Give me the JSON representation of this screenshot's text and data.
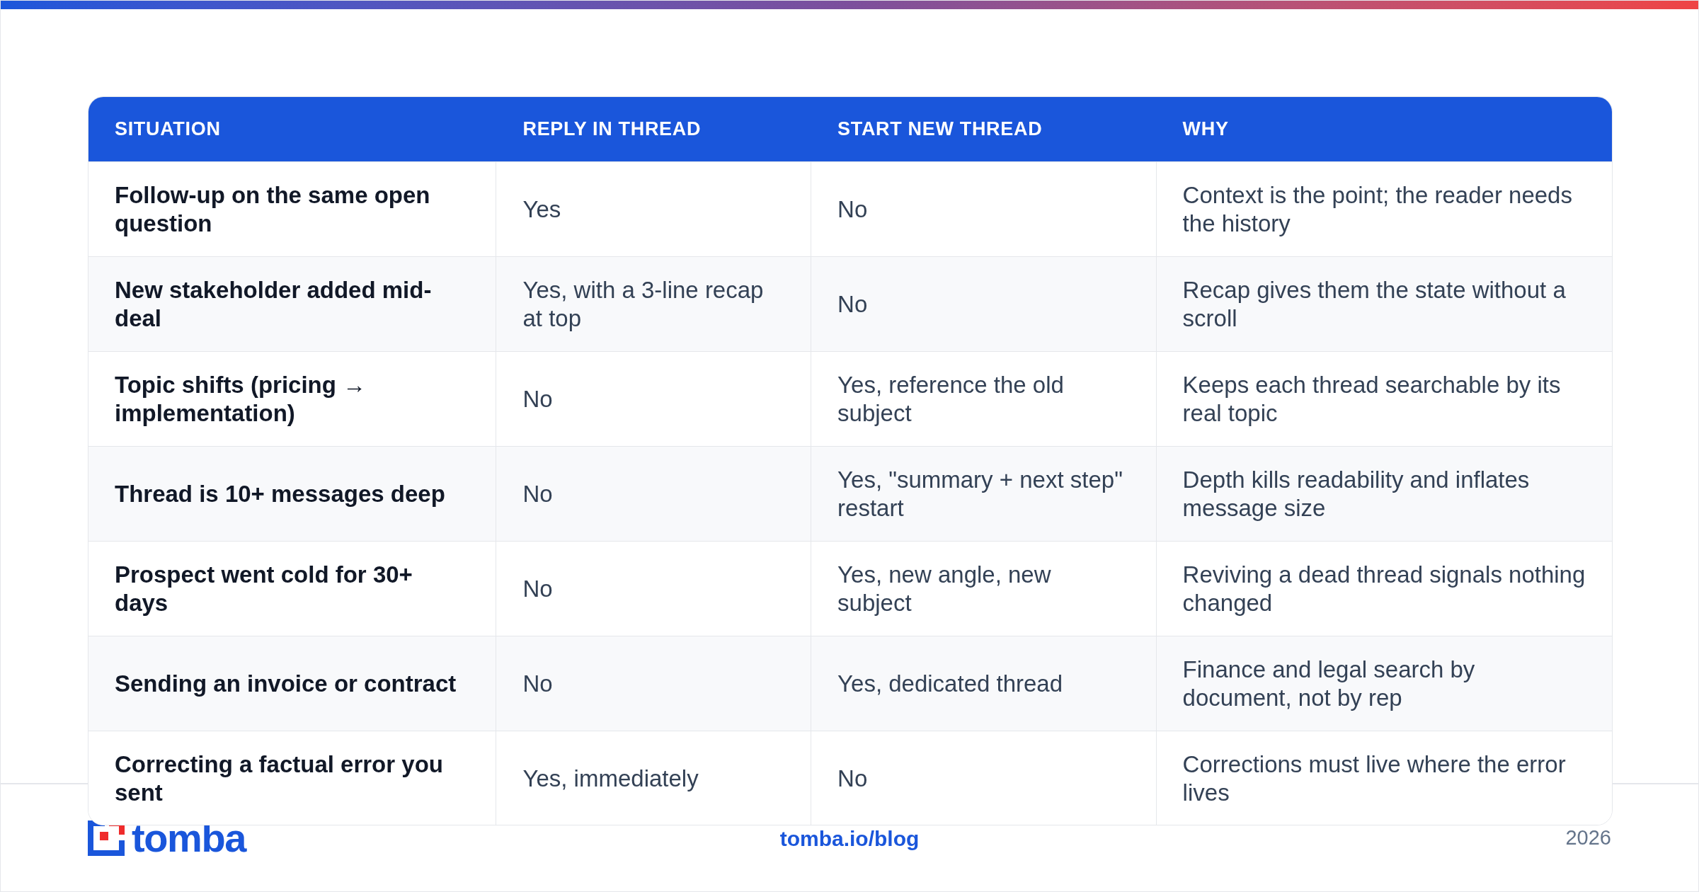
{
  "table": {
    "columns": [
      "SITUATION",
      "REPLY IN THREAD",
      "START NEW THREAD",
      "WHY"
    ],
    "rows": [
      [
        "Follow-up on the same open question",
        "Yes",
        "No",
        "Context is the point; the reader needs the history"
      ],
      [
        "New stakeholder added mid-deal",
        "Yes, with a 3-line recap at top",
        "No",
        "Recap gives them the state without a scroll"
      ],
      [
        "Topic shifts (pricing → implementation)",
        "No",
        "Yes, reference the old subject",
        "Keeps each thread searchable by its real topic"
      ],
      [
        "Thread is 10+ messages deep",
        "No",
        "Yes, \"summary + next step\" restart",
        "Depth kills readability and inflates message size"
      ],
      [
        "Prospect went cold for 30+ days",
        "No",
        "Yes, new angle, new subject",
        "Reviving a dead thread signals nothing changed"
      ],
      [
        "Sending an invoice or contract",
        "No",
        "Yes, dedicated thread",
        "Finance and legal search by document, not by rep"
      ],
      [
        "Correcting a factual error you sent",
        "Yes, immediately",
        "No",
        "Corrections must live where the error lives"
      ]
    ]
  },
  "footer": {
    "logo": "tomba",
    "link": "tomba.io/blog",
    "year": "2026"
  }
}
